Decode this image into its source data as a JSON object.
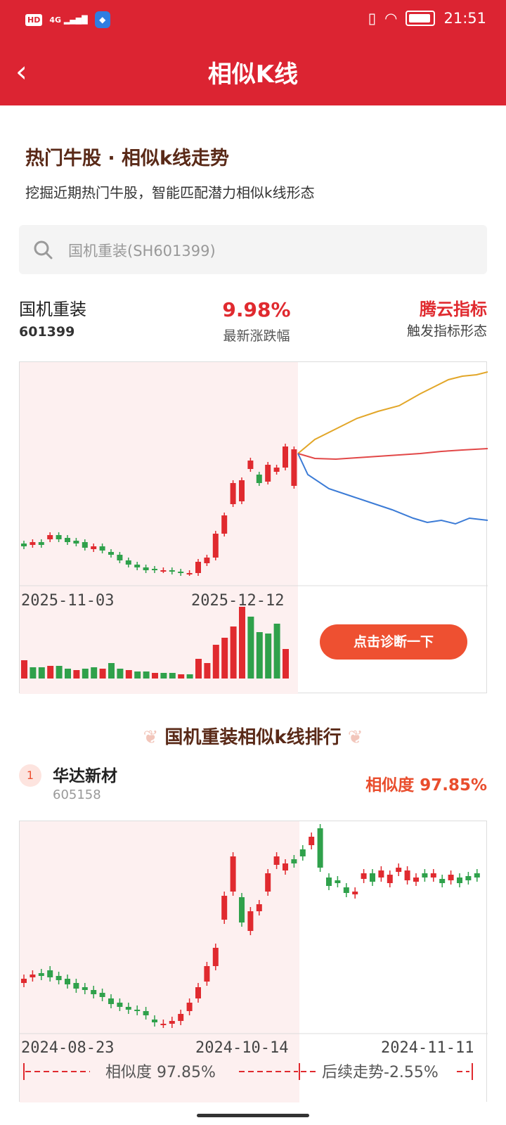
{
  "status": {
    "hd": "HD",
    "signal": "4G",
    "time": "21:51"
  },
  "nav": {
    "back_icon": "chevron-left-icon",
    "title": "相似K线"
  },
  "header": {
    "title": "热门牛股 · 相似k线走势",
    "subtitle": "挖掘近期热门牛股，智能匹配潜力相似k线形态"
  },
  "search": {
    "value": "国机重装(SH601399)"
  },
  "stock": {
    "name": "国机重装",
    "code": "601399",
    "change": "9.98%",
    "change_label": "最新涨跌幅",
    "indicator": "腾云指标",
    "indicator_label": "触发指标形态"
  },
  "chart_main": {
    "type": "candlestick",
    "dates": [
      "2025-11-03",
      "2025-12-12"
    ],
    "prediction_lines": [
      "#e2a628",
      "#e24848",
      "#3b7bd6"
    ],
    "diagnose_button": "点击诊断一下"
  },
  "ranking": {
    "title": "国机重装相似k线排行",
    "items": [
      {
        "rank": "1",
        "name": "华达新材",
        "code": "605158",
        "similarity_label": "相似度 97.85%"
      }
    ]
  },
  "chart_similar": {
    "type": "candlestick",
    "dates": [
      "2024-08-23",
      "2024-10-14",
      "2024-11-11"
    ],
    "footer_similarity": "相似度 97.85%",
    "footer_trend": "后续走势-2.55%"
  },
  "colors": {
    "brand": "#dc2432",
    "up": "#e02a2f",
    "down": "#2fa14b",
    "accent": "#ee5031"
  }
}
